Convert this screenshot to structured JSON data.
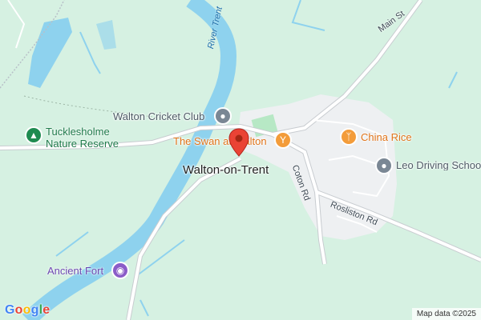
{
  "labels": {
    "cricket_club": "Walton Cricket Club",
    "nature_reserve": "Tucklesholme\nNature Reserve",
    "swan": "The Swan at Walton",
    "place": "Walton-on-Trent",
    "china_rice": "China Rice",
    "leo_driving": "Leo Driving School",
    "ancient_fort": "Ancient Fort"
  },
  "roads": {
    "main_st": "Main St",
    "coton_rd": "Coton Rd",
    "rosliston_rd": "Rosliston Rd"
  },
  "water": {
    "river_trent": "River Trent"
  },
  "attribution": {
    "logo_letters": [
      "G",
      "o",
      "o",
      "g",
      "l",
      "e"
    ],
    "logo_colors": [
      "#4285F4",
      "#EA4335",
      "#FBBC05",
      "#4285F4",
      "#34A853",
      "#EA4335"
    ],
    "map_data": "Map data ©2025"
  },
  "colors": {
    "land": "#d6f1e2",
    "water": "#8ed2ee",
    "road": "#ffffff",
    "urban": "#eef0f2",
    "marker": "#ea4335"
  }
}
